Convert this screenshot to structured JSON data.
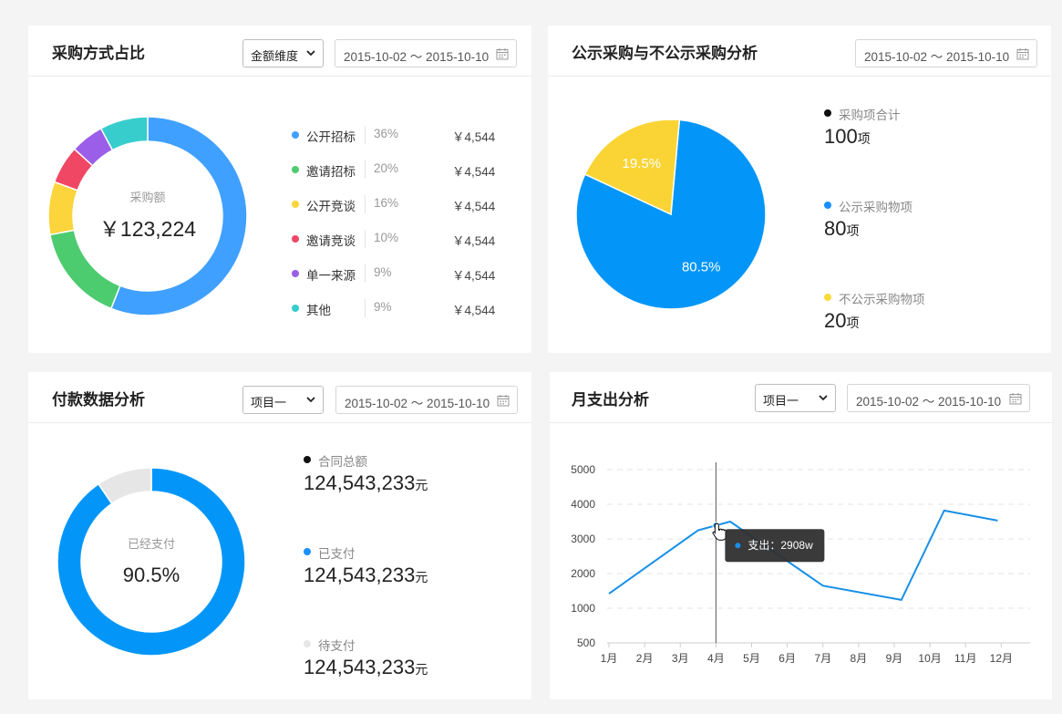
{
  "cards": {
    "purchase_method": {
      "title": "采购方式占比",
      "dimension_select": "金额维度",
      "date_range": "2015-10-02 ～ 2015-10-10",
      "center_label": "采购额",
      "center_value": "￥123,224"
    },
    "public_purchase": {
      "title": "公示采购与不公示采购分析",
      "date_range": "2015-10-02 ～ 2015-10-10",
      "stats": [
        {
          "label": "采购项合计",
          "value": "100",
          "unit": "项",
          "color": "#111111"
        },
        {
          "label": "公示采购物项",
          "value": "80",
          "unit": "项",
          "color": "#1890ff"
        },
        {
          "label": "不公示采购物项",
          "value": "20",
          "unit": "项",
          "color": "#fadb3a"
        }
      ]
    },
    "payment": {
      "title": "付款数据分析",
      "project_select": "项目一",
      "date_range": "2015-10-02 ～ 2015-10-10",
      "center_label": "已经支付",
      "center_value": "90.5%",
      "stats": [
        {
          "label": "合同总额",
          "value": "124,543,233",
          "unit": "元",
          "color": "#111111"
        },
        {
          "label": "已支付",
          "value": "124,543,233",
          "unit": "元",
          "color": "#1890ff"
        },
        {
          "label": "待支付",
          "value": "124,543,233",
          "unit": "元",
          "color": "#e6e6e6"
        }
      ]
    },
    "monthly": {
      "title": "月支出分析",
      "project_select": "项目一",
      "date_range": "2015-10-02 ～ 2015-10-10",
      "tooltip": "支出：2908w"
    }
  },
  "chart_data": [
    {
      "type": "pie",
      "variant": "donut",
      "title": "采购方式占比",
      "categories": [
        "公开招标",
        "邀请招标",
        "公开竞谈",
        "邀请竞谈",
        "单一来源",
        "其他"
      ],
      "labels": [
        "36%",
        "20%",
        "16%",
        "10%",
        "9%",
        "9%"
      ],
      "amounts": [
        "￥4,544",
        "￥4,544",
        "￥4,544",
        "￥4,544",
        "￥4,544",
        "￥4,544"
      ],
      "values": [
        56,
        16,
        8.6,
        6.2,
        5.4,
        7.8
      ],
      "colors": [
        "#40a0ff",
        "#4ccb6f",
        "#fcd43c",
        "#f04864",
        "#9b5ee8",
        "#37cdcc"
      ],
      "legend": "right"
    },
    {
      "type": "pie",
      "title": "公示采购与不公示采购分析",
      "categories": [
        "公示采购物项",
        "不公示采购物项"
      ],
      "values": [
        80.5,
        19.5
      ],
      "labels": [
        "80.5%",
        "19.5%"
      ],
      "colors": [
        "#0396f8",
        "#fad435"
      ]
    },
    {
      "type": "pie",
      "variant": "donut",
      "title": "付款数据分析",
      "categories": [
        "已支付",
        "待支付"
      ],
      "values": [
        90.5,
        9.5
      ],
      "colors": [
        "#0396f8",
        "#e6e6e6"
      ]
    },
    {
      "type": "line",
      "title": "月支出分析",
      "categories": [
        "1月",
        "2月",
        "3月",
        "4月",
        "5月",
        "6月",
        "7月",
        "8月",
        "9月",
        "10月",
        "11月",
        "12月"
      ],
      "points": [
        {
          "x": 1.0,
          "y": 1420
        },
        {
          "x": 3.5,
          "y": 3250
        },
        {
          "x": 4.4,
          "y": 3500
        },
        {
          "x": 7.0,
          "y": 1650
        },
        {
          "x": 9.2,
          "y": 1240
        },
        {
          "x": 10.4,
          "y": 3820
        },
        {
          "x": 11.9,
          "y": 3530
        }
      ],
      "y_ticks": [
        500,
        1000,
        2000,
        3000,
        4000,
        5000
      ],
      "ylim": [
        500,
        5000
      ],
      "hover_x": 4,
      "grid": "horizontal-dashed",
      "color": "#1890e8"
    }
  ]
}
